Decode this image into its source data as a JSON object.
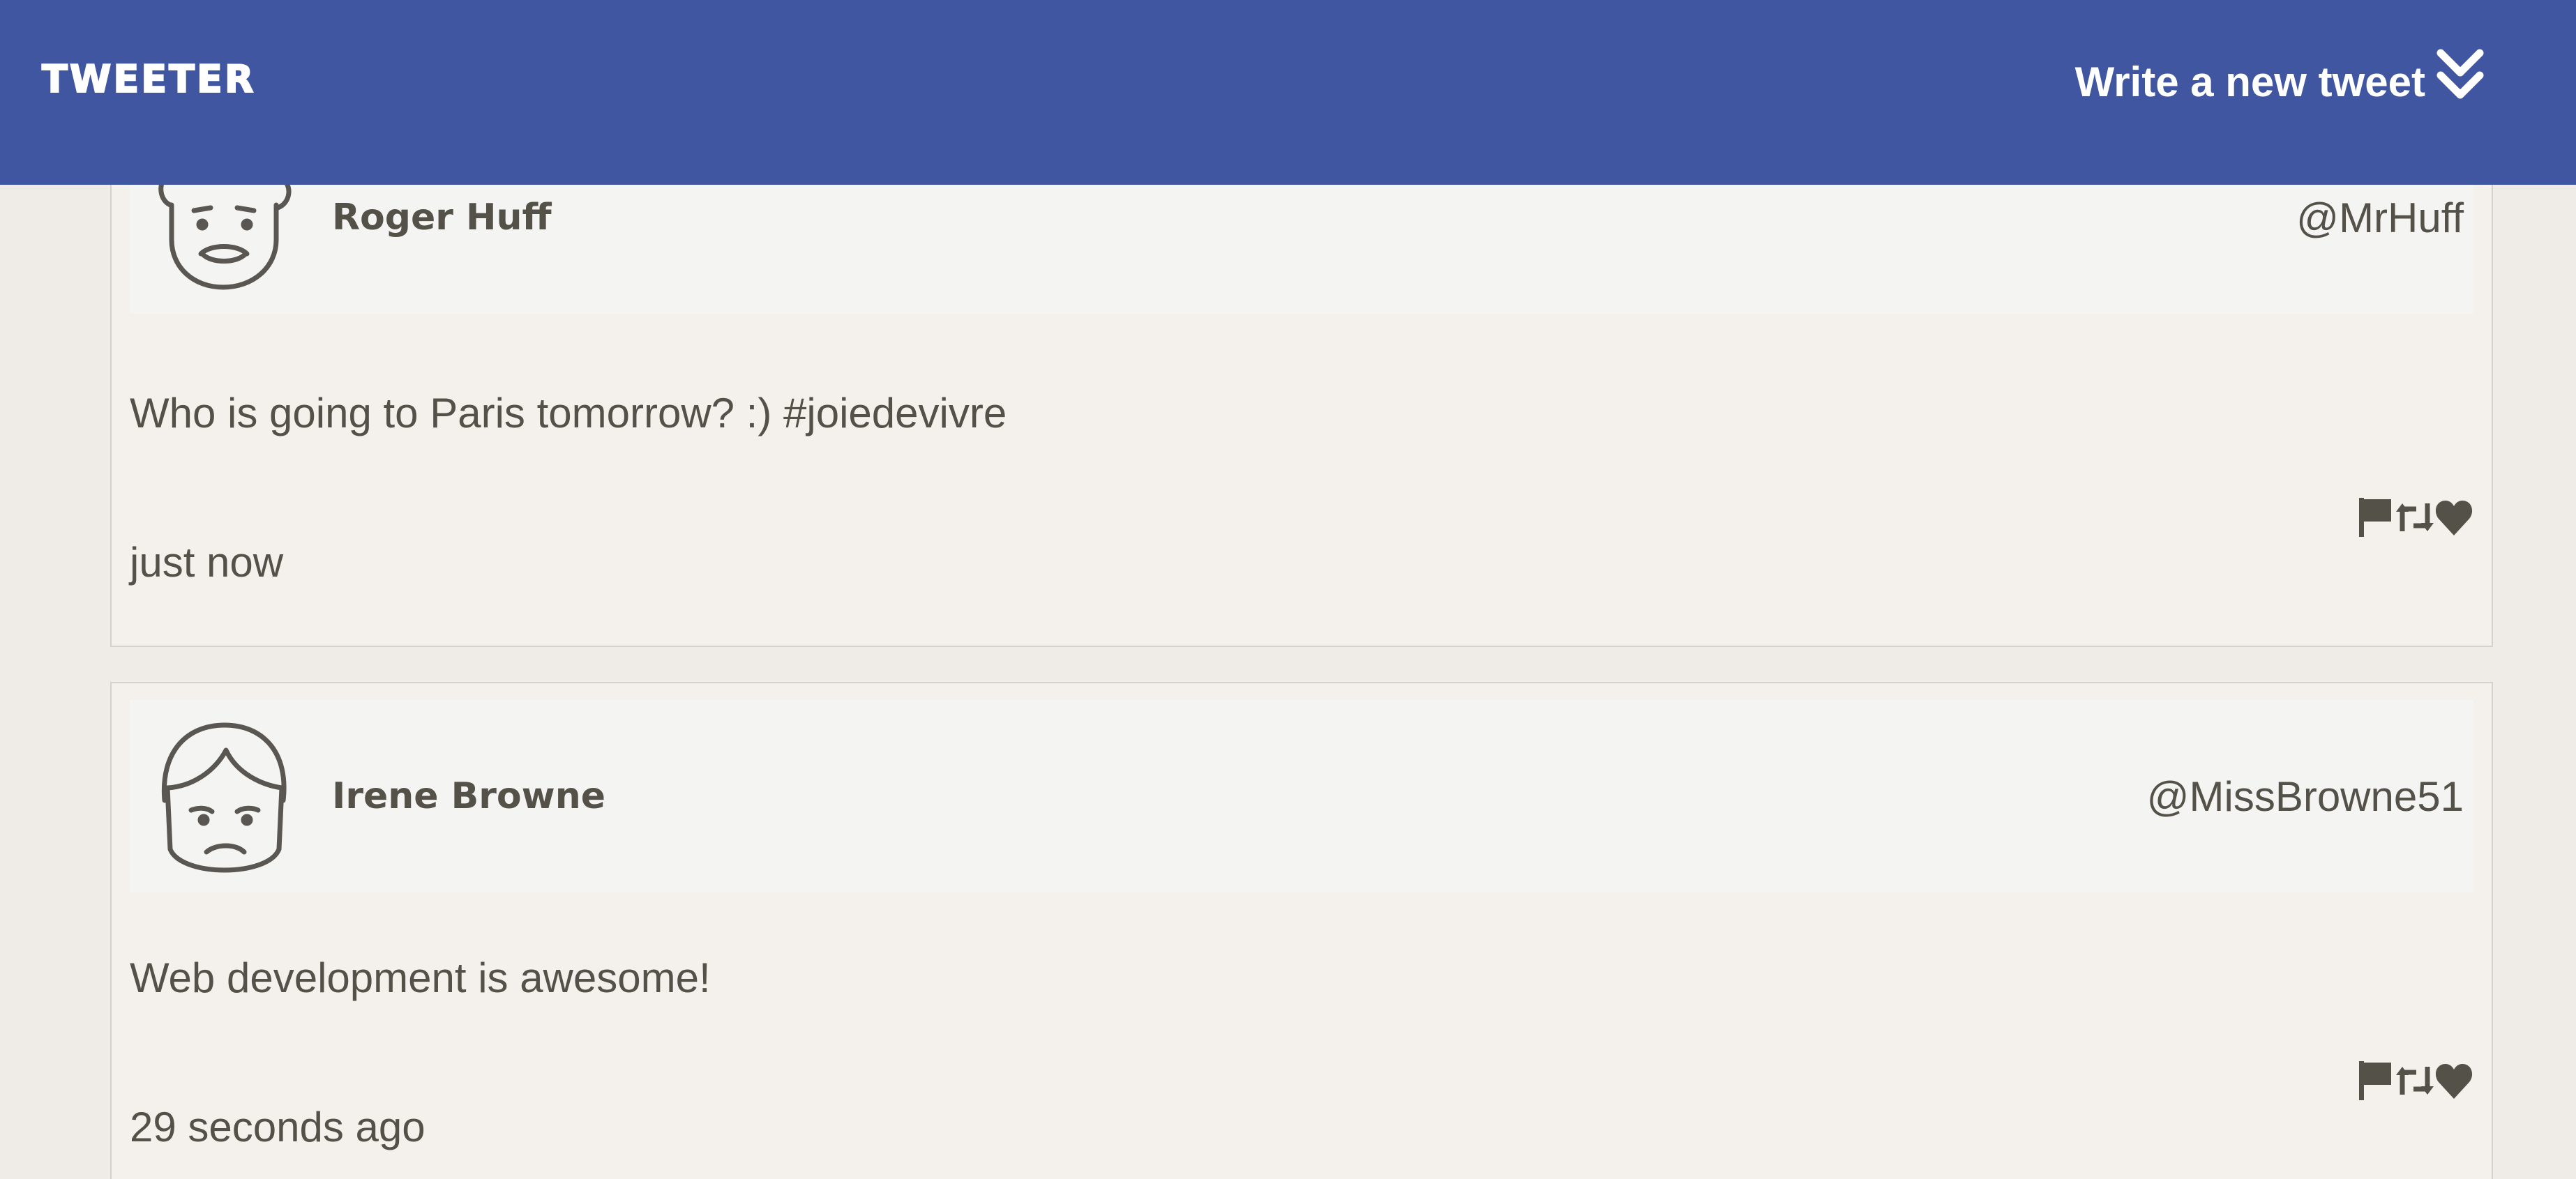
{
  "nav": {
    "brand": "TWEETER",
    "compose_label": "Write a new tweet",
    "compose_icon": "double-chevron-down-icon",
    "color": "#4056a1"
  },
  "tweets": [
    {
      "user": {
        "name": "Roger Huff",
        "handle": "@MrHuff",
        "avatar": "curly-hair-face-avatar"
      },
      "content": "Who is going to Paris tomorrow? :) #joiedevivre",
      "time": "just now",
      "actions": [
        "flag-icon",
        "retweet-icon",
        "heart-icon"
      ]
    },
    {
      "user": {
        "name": "Irene Browne",
        "handle": "@MissBrowne51",
        "avatar": "sad-face-avatar"
      },
      "content": "Web development is awesome!",
      "time": "29 seconds ago",
      "actions": [
        "flag-icon",
        "retweet-icon",
        "heart-icon"
      ]
    }
  ]
}
